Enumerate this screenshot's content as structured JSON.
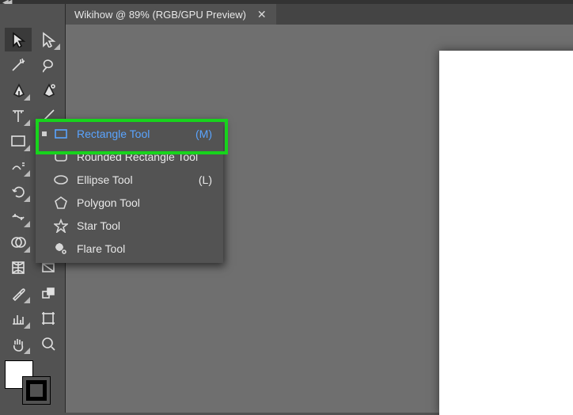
{
  "tab": {
    "title": "Wikihow @ 89% (RGB/GPU Preview)"
  },
  "flyout": {
    "items": [
      {
        "label": "Rectangle Tool",
        "shortcut": "(M)"
      },
      {
        "label": "Rounded Rectangle Tool",
        "shortcut": ""
      },
      {
        "label": "Ellipse Tool",
        "shortcut": "(L)"
      },
      {
        "label": "Polygon Tool",
        "shortcut": ""
      },
      {
        "label": "Star Tool",
        "shortcut": ""
      },
      {
        "label": "Flare Tool",
        "shortcut": ""
      }
    ]
  }
}
